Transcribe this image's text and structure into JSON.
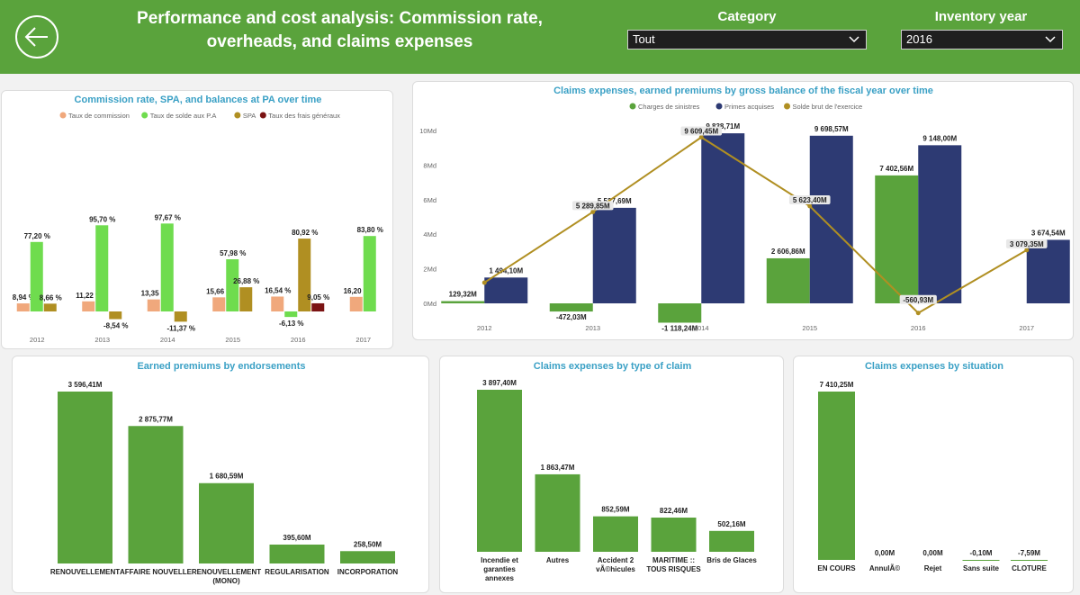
{
  "header": {
    "title_line1": "Performance and cost analysis: Commission rate,",
    "title_line2": "overheads, and claims expenses",
    "category_label": "Category",
    "category_value": "Tout",
    "year_label": "Inventory year",
    "year_value": "2016",
    "back_icon": "back-arrow-icon",
    "brand_color": "#5aa33c"
  },
  "chart_data": [
    {
      "id": "commission",
      "type": "bar",
      "title": "Commission rate, SPA, and balances at PA over time",
      "categories": [
        "2012",
        "2013",
        "2014",
        "2015",
        "2016",
        "2017"
      ],
      "series": [
        {
          "name": "Taux de commission",
          "color": "#f0a87c",
          "values": [
            8.94,
            11.22,
            13.35,
            15.66,
            16.54,
            16.2
          ],
          "labels": [
            "8,94 %",
            "11,22 %",
            "13,35 %",
            "15,66 %",
            "16,54 %",
            "16,20 %"
          ]
        },
        {
          "name": "Taux de solde aux P.A",
          "color": "#6fdc4e",
          "values": [
            77.2,
            95.7,
            97.67,
            57.98,
            -6.13,
            83.8
          ],
          "labels": [
            "77,20 %",
            "95,70 %",
            "97,67 %",
            "57,98 %",
            "-6,13 %",
            "83,80 %"
          ]
        },
        {
          "name": "SPA",
          "color": "#b08f22",
          "values": [
            8.66,
            -8.54,
            -11.37,
            26.88,
            80.92,
            null
          ],
          "labels": [
            "8,66 %",
            "-8,54 %",
            "-11,37 %",
            "26,88 %",
            "80,92 %",
            ""
          ]
        },
        {
          "name": "Taux des frais généraux",
          "color": "#7b1313",
          "values": [
            null,
            null,
            null,
            null,
            9.05,
            null
          ],
          "labels": [
            "",
            "",
            "",
            "",
            "9,05 %",
            ""
          ]
        }
      ],
      "ylim": [
        -15,
        100
      ]
    },
    {
      "id": "claims_premiums",
      "type": "bar",
      "title": "Claims expenses, earned premiums by gross balance of the fiscal year over time",
      "categories": [
        "2012",
        "2013",
        "2014",
        "2015",
        "2016",
        "2017"
      ],
      "yticks": [
        "0Md",
        "2Md",
        "4Md",
        "6Md",
        "8Md",
        "10Md"
      ],
      "ylim": [
        -1.2,
        10
      ],
      "series": [
        {
          "name": "Charges de sinistres",
          "color": "#5aa33c",
          "values": [
            0.12932,
            -0.47203,
            -1.11824,
            2.60686,
            7.40256,
            null
          ],
          "labels": [
            "129,32M",
            "-472,03M",
            "-1 118,24M",
            "2 606,86M",
            "7 402,56M",
            ""
          ]
        },
        {
          "name": "Primes acquises",
          "color": "#2d3a73",
          "values": [
            1.4941,
            5.52769,
            9.83871,
            9.69857,
            9.148,
            3.67454
          ],
          "labels": [
            "1 494,10M",
            "5 527,69M",
            "9 838,71M",
            "9 698,57M",
            "9 148,00M",
            "3 674,54M"
          ]
        },
        {
          "name": "Solde brut de l'exercice",
          "color": "#b08f22",
          "type": "line",
          "values": [
            1.2,
            5.28985,
            9.60945,
            5.6234,
            -0.56093,
            3.07935
          ],
          "labels": [
            "",
            "5 289,85M",
            "9 609,45M",
            "5 623,40M",
            "-560,93M",
            "3 079,35M"
          ]
        }
      ]
    },
    {
      "id": "endorsements",
      "type": "bar",
      "title": "Earned premiums by endorsements",
      "categories": [
        [
          "RENOUVELLEMENT"
        ],
        [
          "AFFAIRE NOUVELLE"
        ],
        [
          "RENOUVELLEMENT",
          "(MONO)"
        ],
        [
          "REGULARISATION"
        ],
        [
          "INCORPORATION"
        ]
      ],
      "values": [
        3596.41,
        2875.77,
        1680.59,
        395.6,
        258.5
      ],
      "labels": [
        "3 596,41M",
        "2 875,77M",
        "1 680,59M",
        "395,60M",
        "258,50M"
      ],
      "color": "#5aa33c"
    },
    {
      "id": "claim_type",
      "type": "bar",
      "title": "Claims expenses by type of claim",
      "categories": [
        [
          "Incendie et",
          "garanties",
          "annexes"
        ],
        [
          "Autres"
        ],
        [
          "Accident 2",
          "vÃ©hicules"
        ],
        [
          "MARITIME ::",
          "TOUS RISQUES"
        ],
        [
          "Bris de Glaces"
        ]
      ],
      "values": [
        3897.4,
        1863.47,
        852.59,
        822.46,
        502.16
      ],
      "labels": [
        "3 897,40M",
        "1 863,47M",
        "852,59M",
        "822,46M",
        "502,16M"
      ],
      "color": "#5aa33c"
    },
    {
      "id": "situation",
      "type": "bar",
      "title": "Claims expenses by situation",
      "categories": [
        [
          "EN COURS"
        ],
        [
          "AnnulÃ©"
        ],
        [
          "Rejet"
        ],
        [
          "Sans suite"
        ],
        [
          "CLOTURE"
        ]
      ],
      "values": [
        7410.25,
        0,
        0,
        -0.1,
        -7.59
      ],
      "labels": [
        "7 410,25M",
        "0,00M",
        "0,00M",
        "-0,10M",
        "-7,59M"
      ],
      "color": "#5aa33c"
    }
  ]
}
